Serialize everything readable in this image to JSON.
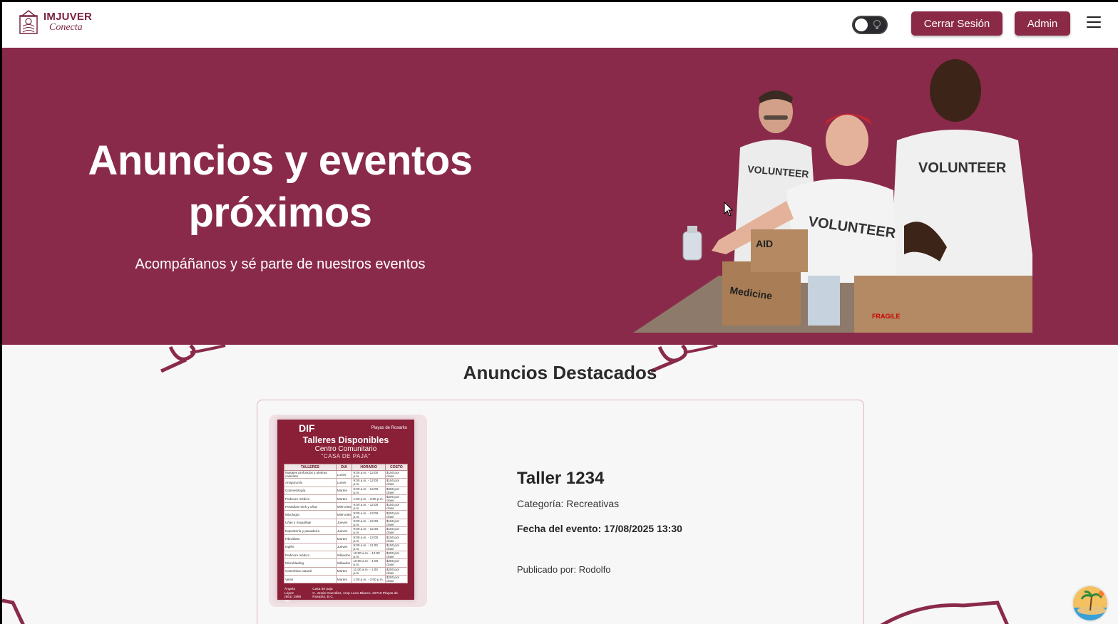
{
  "header": {
    "logo_title": "IMJUVER",
    "logo_subtitle": "Conecta",
    "logout_label": "Cerrar Sesión",
    "admin_label": "Admin"
  },
  "hero": {
    "title": "Anuncios y eventos próximos",
    "subtitle": "Acompáñanos y sé parte de nuestros eventos",
    "photo_labels": {
      "shirt": "VOLUNTEER",
      "box_aid": "AID",
      "box_medicine": "Medicine",
      "box_fragile": "FRAGILE"
    }
  },
  "featured": {
    "section_title": "Anuncios Destacados",
    "card": {
      "title": "Taller 1234",
      "category": "Categoría: Recreativas",
      "date": "Fecha del evento: 17/08/2025 13:30",
      "author": "Publicado por: Rodolfo",
      "poster": {
        "org": "DIF",
        "municipality": "Playas de Rosarito",
        "title": "Talleres Disponibles",
        "subtitle": "Centro Comunitario",
        "place": "\"CASA DE PAJA\"",
        "columns": [
          "TALLERES",
          "DIA",
          "HORARIO",
          "COSTO"
        ],
        "rows": [
          [
            "Masajes profundos y piedras calientes",
            "Lunes",
            "9:00 a.m. - 12:00 p.m.",
            "$150 por clase"
          ],
          [
            "Amigurumis",
            "Lunes",
            "9:00 a.m. - 12:00 p.m.",
            "$150 por clase"
          ],
          [
            "Cosmetología",
            "Martes",
            "9:00 a.m. - 12:00 p.m.",
            "$250 por clase"
          ],
          [
            "Pedicure médico",
            "Martes",
            "1:00 p.m. - 3:00 p.m.",
            "$200 por clase"
          ],
          [
            "Pestañas mink y uñas",
            "Miércoles",
            "9:00 a.m. - 12:00 p.m.",
            "$150 por clase"
          ],
          [
            "Mixología",
            "Miércoles",
            "9:00 a.m. - 12:00 p.m.",
            "$250 por clase"
          ],
          [
            "Uñas y maquillaje",
            "Jueves",
            "9:00 a.m. - 12:30 p.m.",
            "$150 por clase"
          ],
          [
            "Repostería y panadería",
            "Jueves",
            "9:00 a.m. - 12:30 p.m.",
            "$150 por clase"
          ],
          [
            "Fibroblast",
            "Martes",
            "9:00 a.m. - 12:00 p.m.",
            "$150 por clase"
          ],
          [
            "Inglés",
            "Jueves",
            "9:00 a.m. - 11:00 p.m.",
            "$150 por clase"
          ],
          [
            "Pedicure médico",
            "Sábados",
            "10:00 a.m. - 12:00 p.m.",
            "$200 por clase"
          ],
          [
            "Microblading",
            "Sábados",
            "10:00 a.m. - 1:00 p.m.",
            "$250 por clase"
          ],
          [
            "Cosmética natural",
            "Martes",
            "11:00 a.m. - 1:00 p.m.",
            "$200 por clase"
          ],
          [
            "Velas",
            "Martes",
            "1:00 p.m. - 3:00 p.m.",
            "$200 por clase"
          ]
        ],
        "contact_name": "Ángela López",
        "contact_phone": "(661) 1988 504",
        "address_title": "Casa de paja",
        "address": "C. Jesús González, Amp Lucio Blanco, 22710 Playas de Rosarito, B.C."
      }
    }
  },
  "colors": {
    "brand": "#8a2a4a",
    "button": "#8a2a47",
    "background": "#f8f7f7"
  }
}
